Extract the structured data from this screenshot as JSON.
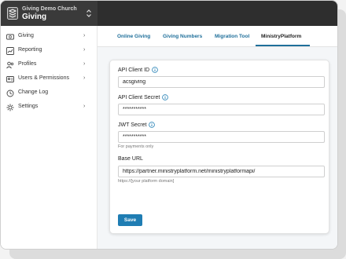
{
  "header": {
    "org_name": "Giving Demo Church",
    "app_name": "Giving"
  },
  "sidebar": {
    "items": [
      {
        "label": "Giving",
        "icon": "dollar-icon",
        "chevron": "›"
      },
      {
        "label": "Reporting",
        "icon": "chart-icon",
        "chevron": "›"
      },
      {
        "label": "Profiles",
        "icon": "people-icon",
        "chevron": "›"
      },
      {
        "label": "Users & Permissions",
        "icon": "user-card-icon",
        "chevron": "›"
      },
      {
        "label": "Change Log",
        "icon": "history-icon"
      },
      {
        "label": "Settings",
        "icon": "gear-icon",
        "chevron": "›"
      }
    ]
  },
  "tabs": [
    {
      "label": "Online Giving"
    },
    {
      "label": "Giving Numbers"
    },
    {
      "label": "Migration Tool"
    },
    {
      "label": "MinistryPlatform"
    }
  ],
  "form": {
    "client_id": {
      "label": "API Client ID",
      "value": "acsgiving"
    },
    "client_secret": {
      "label": "API Client Secret",
      "value": "***********"
    },
    "jwt_secret": {
      "label": "JWT Secret",
      "value": "***********",
      "help": "For payments only"
    },
    "base_url": {
      "label": "Base URL",
      "value": "https://partner.ministryplatform.net/ministryplatformapi/",
      "help": "https://[your platform domain]"
    },
    "save_label": "Save"
  },
  "colors": {
    "accent": "#1f7db3",
    "topbar": "#2e2e2e"
  }
}
